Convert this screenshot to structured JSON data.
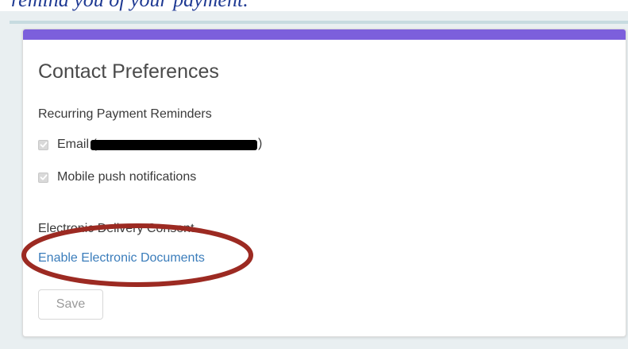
{
  "top_caption": "remind you of your payment.",
  "card": {
    "title": "Contact Preferences",
    "accent_color": "#7c5fdc",
    "recurring": {
      "label": "Recurring Payment Reminders",
      "email_label": "Email (",
      "email_close": ")",
      "email_checked": true,
      "push_label": "Mobile push notifications",
      "push_checked": true
    },
    "consent": {
      "label": "Electronic Delivery Consent",
      "link_text": "Enable Electronic Documents"
    },
    "save_label": "Save"
  },
  "annotation": {
    "shape": "oval",
    "color": "#9c2a22"
  }
}
